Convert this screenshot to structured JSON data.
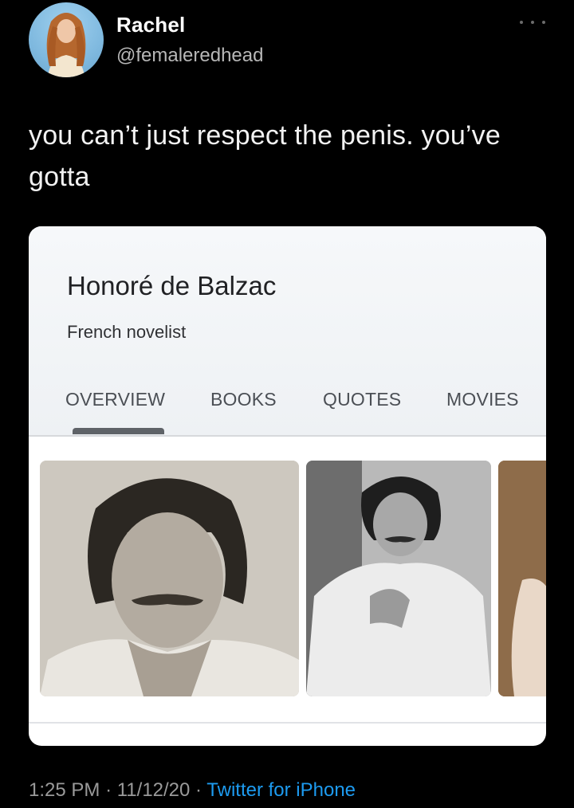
{
  "tweet": {
    "author_name": "Rachel",
    "author_handle": "@femaleredhead",
    "text": "you can’t just respect the penis. you’ve gotta",
    "time": "1:25 PM",
    "date": "11/12/20",
    "source": "Twitter for iPhone",
    "separator": "·"
  },
  "card": {
    "title": "Honoré de Balzac",
    "subtitle": "French novelist",
    "tabs": [
      {
        "label": "OVERVIEW",
        "selected": true
      },
      {
        "label": "BOOKS",
        "selected": false
      },
      {
        "label": "QUOTES",
        "selected": false
      },
      {
        "label": "MOVIES",
        "selected": false
      }
    ]
  },
  "colors": {
    "background": "#000000",
    "link": "#1d9bf0",
    "muted": "#9a9a9a"
  },
  "icons": {
    "more": "more-horizontal-icon"
  }
}
